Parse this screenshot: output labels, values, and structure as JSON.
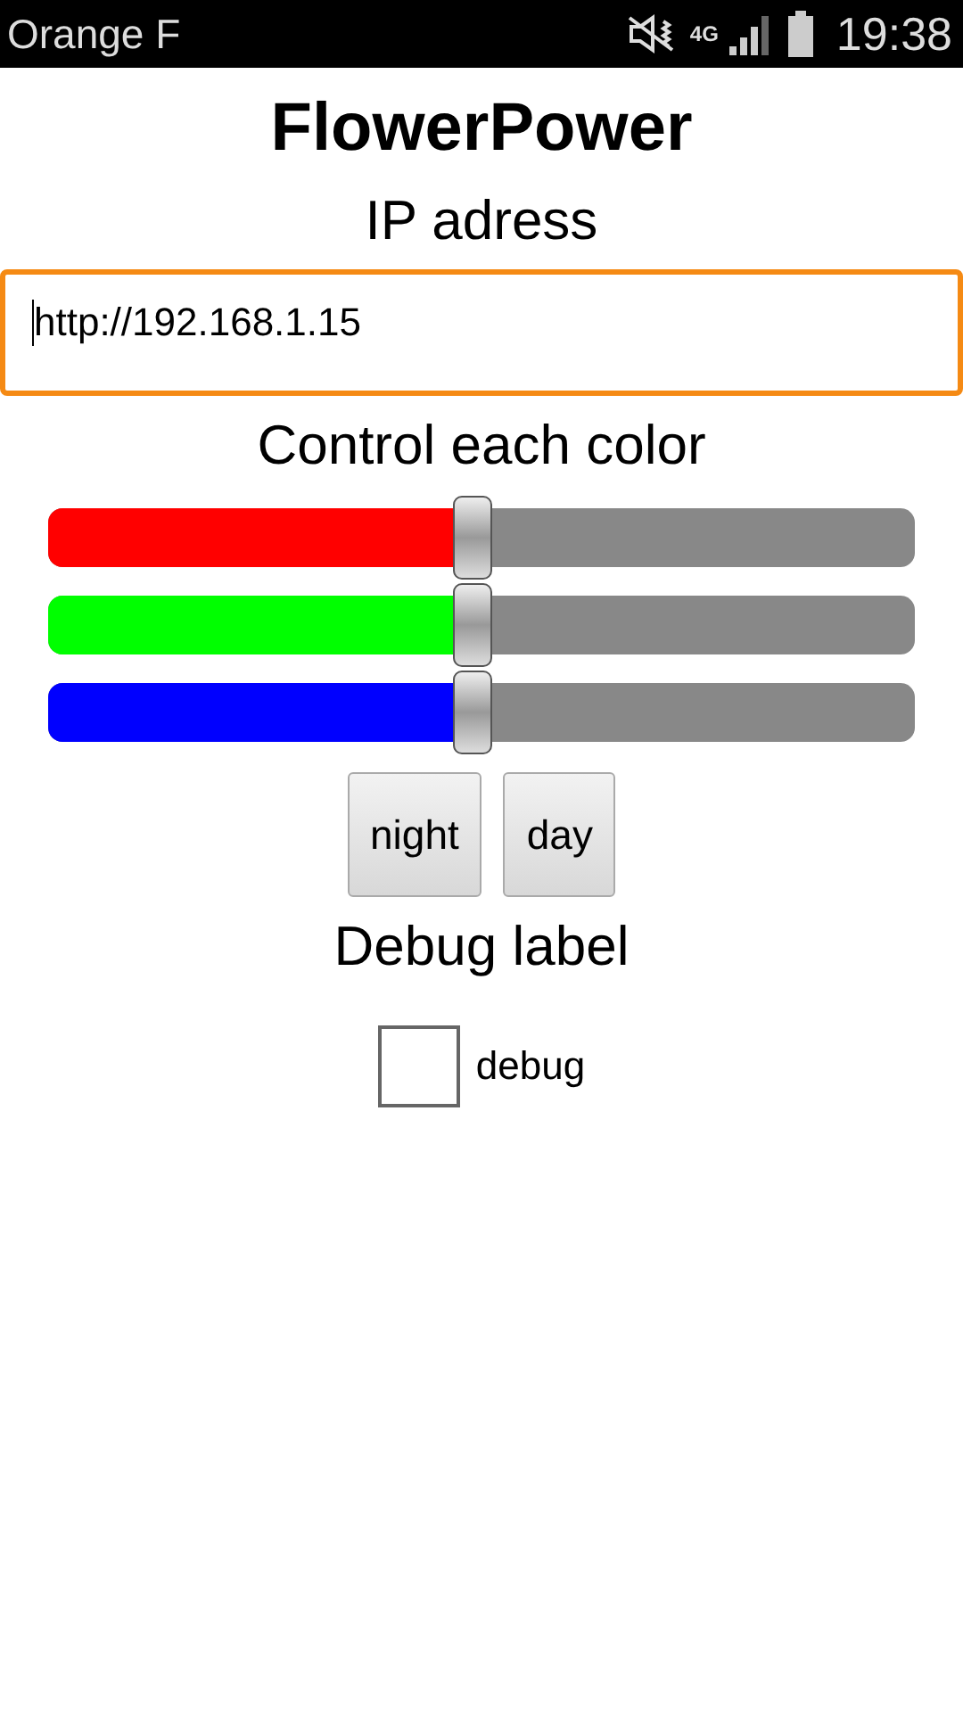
{
  "status_bar": {
    "carrier": "Orange F",
    "network": "4G",
    "time": "19:38"
  },
  "app": {
    "title": "FlowerPower",
    "ip_label": "IP adress",
    "ip_field": {
      "value": "http://192.168.1.15",
      "focused": true
    },
    "color_label": "Control each color",
    "sliders": [
      {
        "color": "#ff0000",
        "level": 0.49
      },
      {
        "color": "#00ff00",
        "level": 0.49
      },
      {
        "color": "#0000ff",
        "level": 0.49
      }
    ],
    "buttons": [
      "night",
      "day"
    ],
    "debug_label": "Debug label",
    "debug_checkbox": {
      "label": "debug",
      "checked": false
    }
  }
}
